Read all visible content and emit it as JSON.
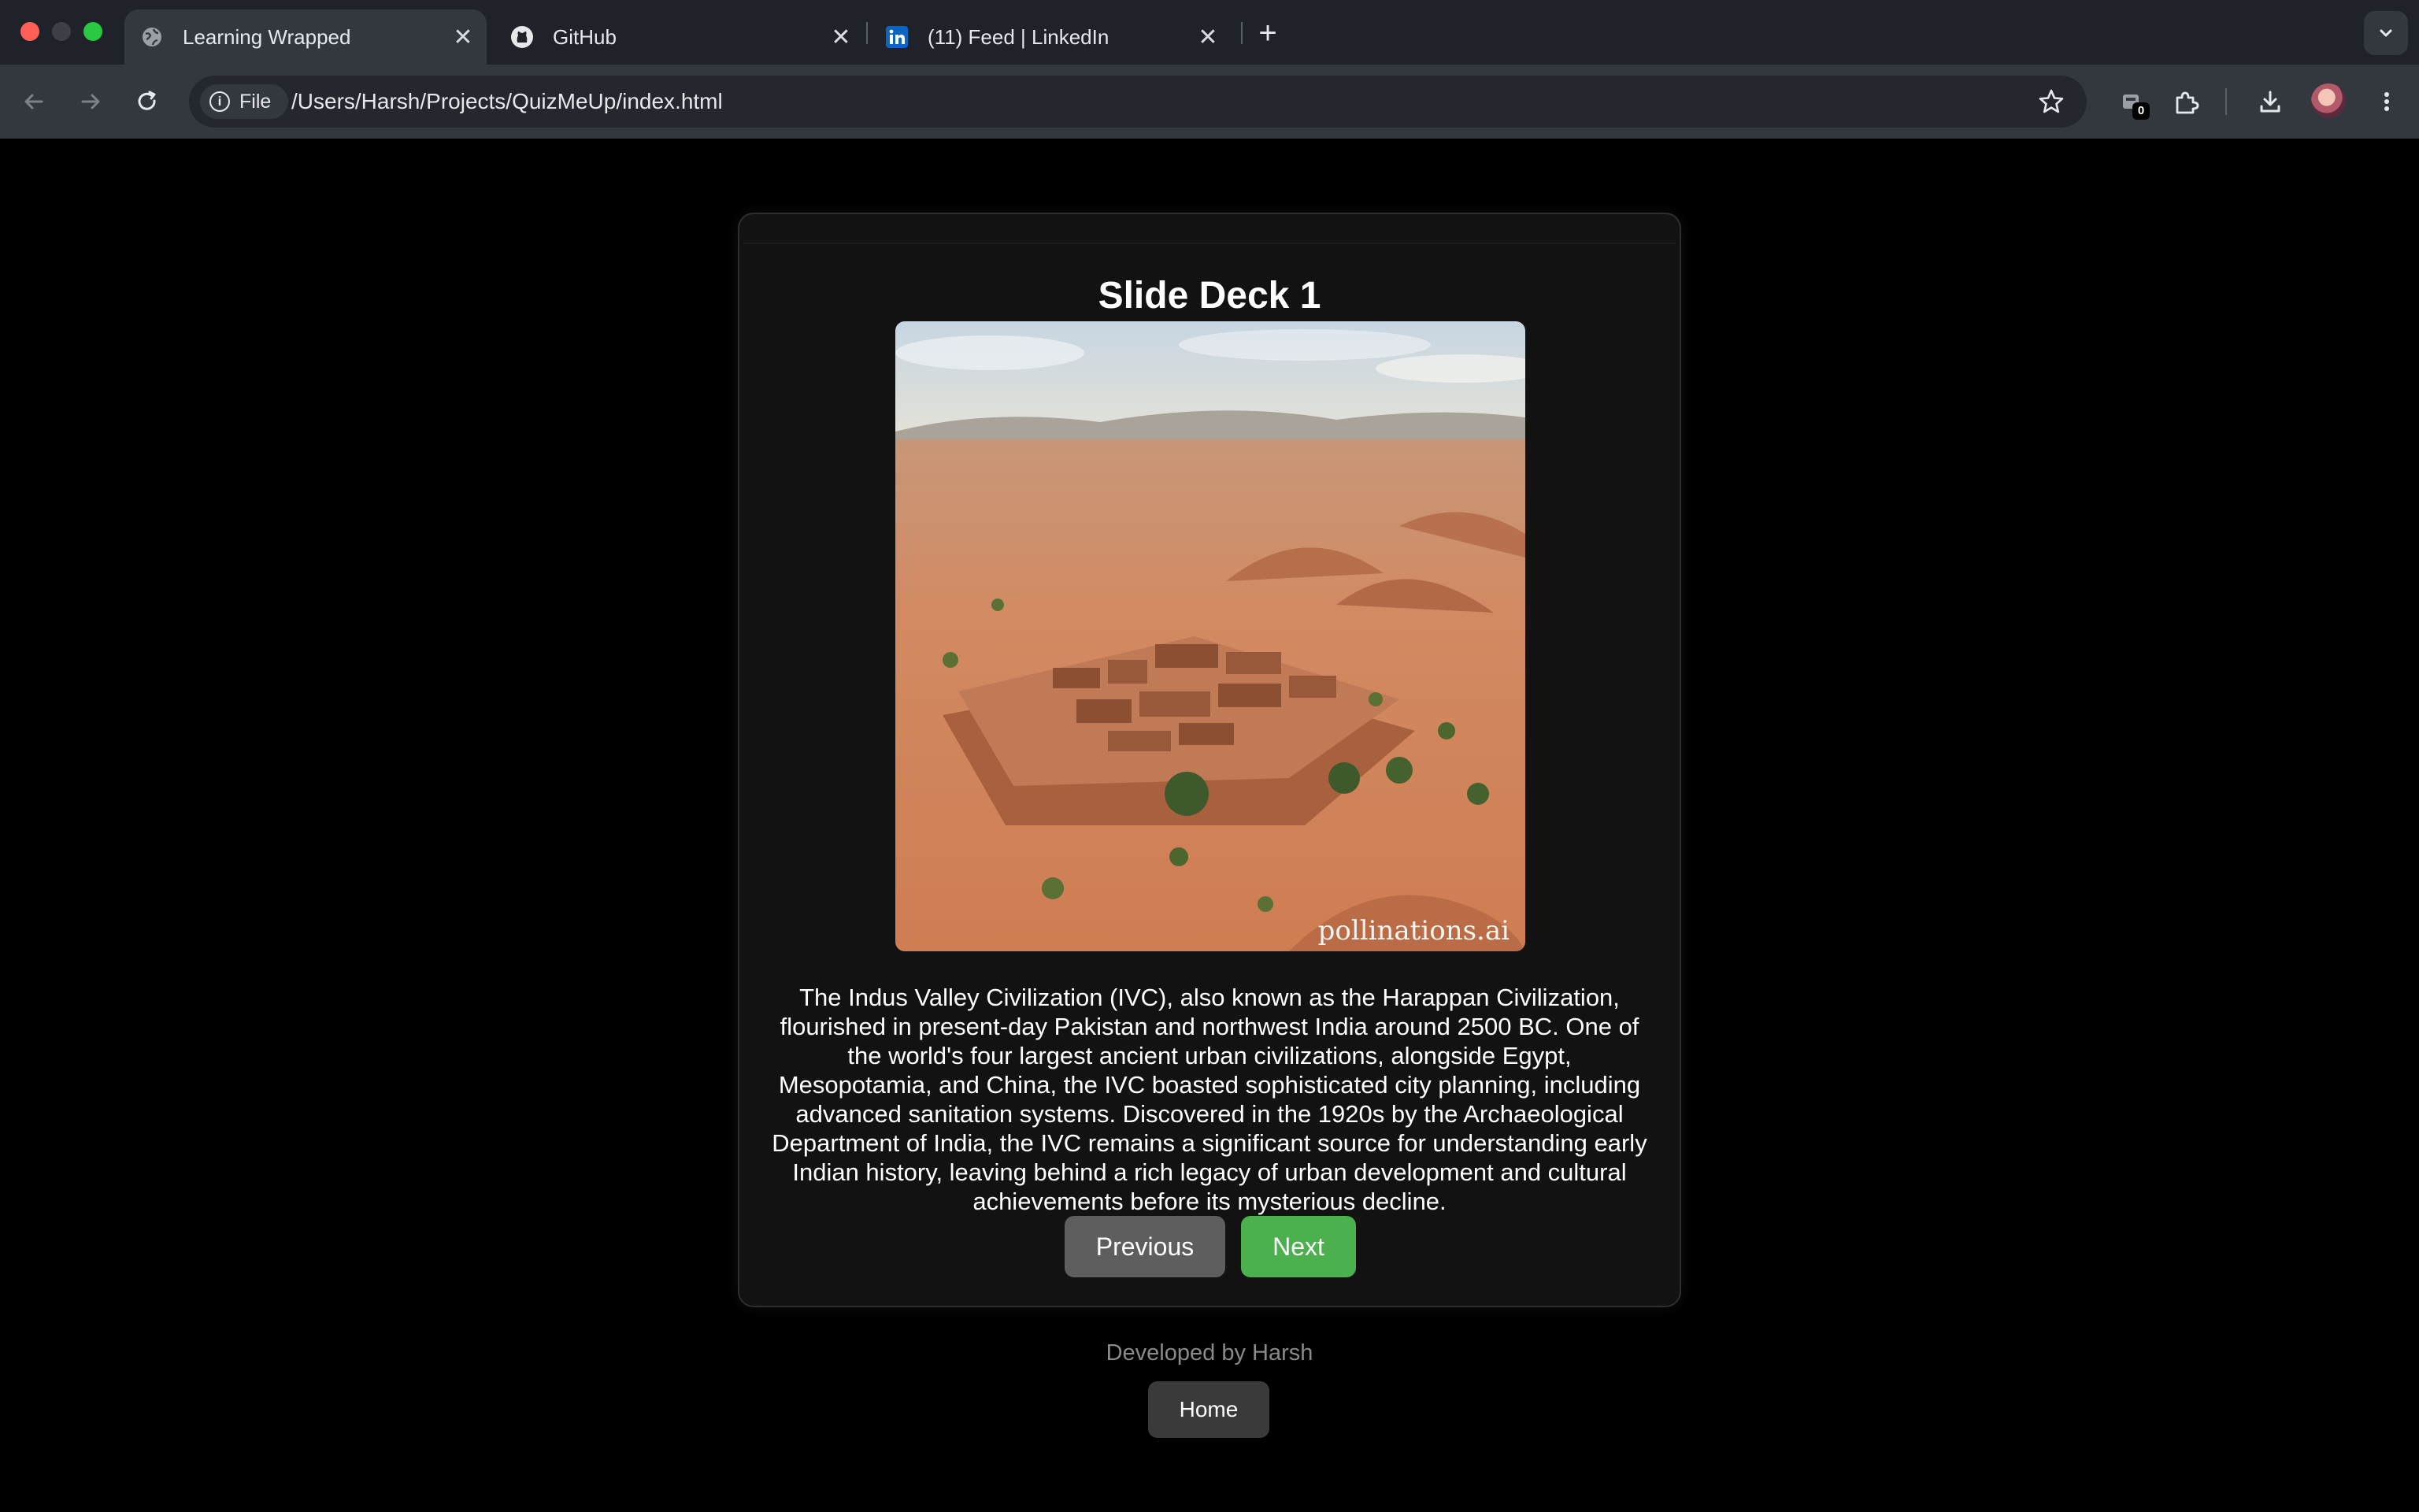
{
  "browser": {
    "tabs": [
      {
        "title": "Learning Wrapped",
        "icon": "globe-icon",
        "active": true
      },
      {
        "title": "GitHub",
        "icon": "github-icon",
        "active": false
      },
      {
        "title": "(11) Feed | LinkedIn",
        "icon": "linkedin-icon",
        "active": false
      }
    ],
    "omnibox": {
      "chip_label": "File",
      "url": "/Users/Harsh/Projects/QuizMeUp/index.html"
    },
    "extension_badge": "0"
  },
  "slide": {
    "title": "Slide Deck 1",
    "image_watermark": "pollinations.ai",
    "text": "The Indus Valley Civilization (IVC), also known as the Harappan Civilization, flourished in present-day Pakistan and northwest India around 2500 BC. One of the world's four largest ancient urban civilizations, alongside Egypt, Mesopotamia, and China, the IVC boasted sophisticated city planning, including advanced sanitation systems. Discovered in the 1920s by the Archaeological Department of India, the IVC remains a significant source for understanding early Indian history, leaving behind a rich legacy of urban development and cultural achievements before its mysterious decline.",
    "prev_label": "Previous",
    "next_label": "Next"
  },
  "footer": {
    "credit": "Developed by Harsh",
    "home_label": "Home"
  },
  "colors": {
    "next_button": "#4cb04f",
    "prev_button": "#5e5e5e",
    "home_button": "#3a3a3a"
  }
}
